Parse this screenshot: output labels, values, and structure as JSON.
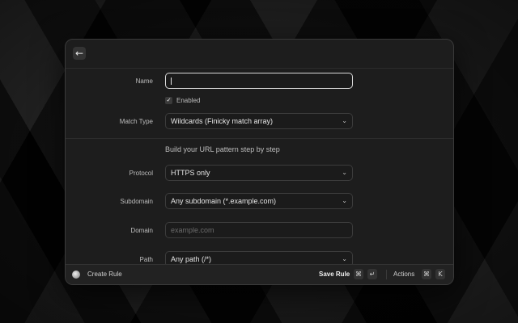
{
  "form": {
    "name_label": "Name",
    "name_value": "",
    "enabled_label": "Enabled",
    "enabled_checked": true,
    "match_type_label": "Match Type",
    "match_type_value": "Wildcards (Finicky match array)",
    "builder_title": "Build your URL pattern step by step",
    "protocol_label": "Protocol",
    "protocol_value": "HTTPS only",
    "subdomain_label": "Subdomain",
    "subdomain_value": "Any subdomain (*.example.com)",
    "domain_label": "Domain",
    "domain_placeholder": "example.com",
    "path_label": "Path",
    "path_value": "Any path (/*)"
  },
  "footer": {
    "title": "Create Rule",
    "save_label": "Save Rule",
    "save_key_1": "⌘",
    "save_key_2": "↵",
    "actions_label": "Actions",
    "actions_key_1": "⌘",
    "actions_key_2": "K"
  },
  "icons": {
    "back": "arrow-left-icon",
    "chevron": "chevron-up-down-icon",
    "app": "app-logo-icon"
  },
  "colors": {
    "window_bg": "#1d1d1d",
    "focus_border": "#d9d9d9",
    "text_primary": "#e6e6e6",
    "text_secondary": "#bdbdbd"
  }
}
